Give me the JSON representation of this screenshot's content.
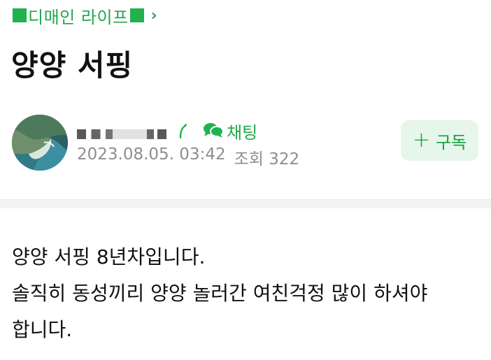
{
  "category": {
    "label": "디매인 라이프",
    "chevron_icon": "chevron-right-icon",
    "color": "#1fa84a"
  },
  "post": {
    "title": "양양 서핑",
    "author": {
      "avatar_icon": "beach-aerial-avatar",
      "nickname_redacted": true,
      "grade_icon": "sprout-icon",
      "chat_label": "채팅"
    },
    "date": "2023.08.05. 03:42",
    "views_label": "조회 322",
    "subscribe_label": "구독",
    "body_lines": [
      "양양 서핑 8년차입니다.",
      "솔직히 동성끼리 양양 놀러간 여친걱정 많이 하셔야",
      "합니다."
    ]
  },
  "colors": {
    "accent": "#1fa84a",
    "subscribe_bg": "#e6f6ea",
    "meta_text": "#8e8e8e"
  }
}
